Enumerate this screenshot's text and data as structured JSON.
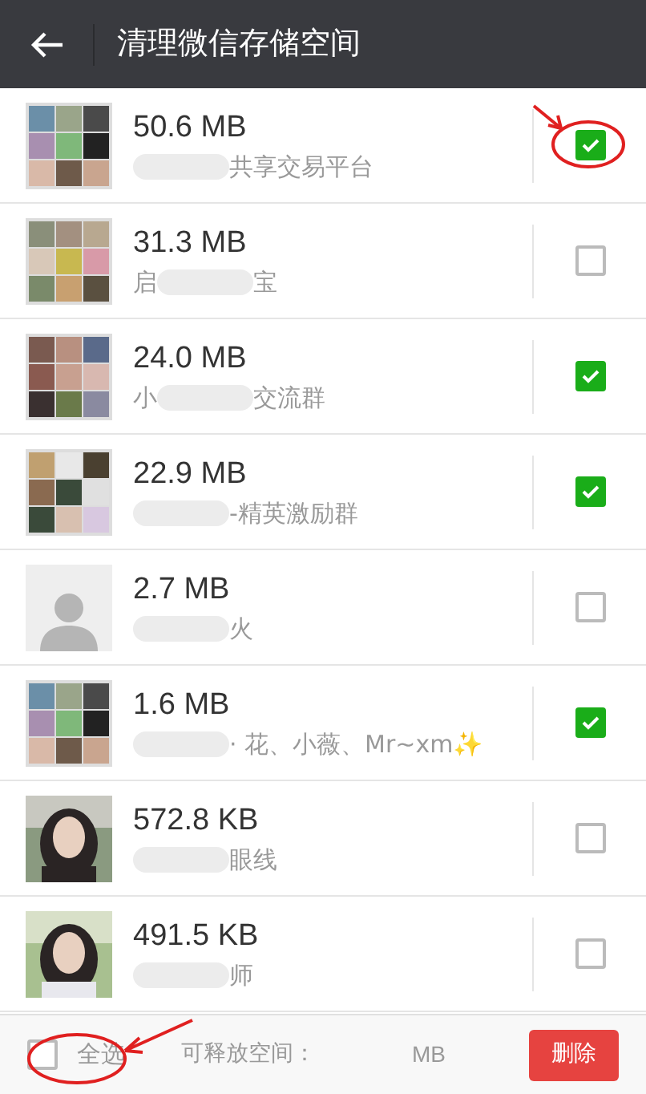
{
  "header": {
    "title": "清理微信存储空间"
  },
  "chats": [
    {
      "size": "50.6 MB",
      "name_after": "共享交易平台",
      "kind": "group",
      "checked": true
    },
    {
      "size": "31.3 MB",
      "name_before": "启",
      "name_after": "宝",
      "kind": "group",
      "checked": false
    },
    {
      "size": "24.0 MB",
      "name_before": "小",
      "name_after": "交流群",
      "kind": "group",
      "checked": true
    },
    {
      "size": "22.9 MB",
      "name_after": "-精英激励群",
      "kind": "group",
      "checked": true
    },
    {
      "size": "2.7 MB",
      "name_after": "火",
      "kind": "default",
      "checked": false
    },
    {
      "size": "1.6 MB",
      "name_after": "· 花、小薇、Mr~xm✨",
      "kind": "group",
      "checked": true
    },
    {
      "size": "572.8 KB",
      "name_after": "眼线",
      "checked": false
    },
    {
      "size": "491.5 KB",
      "name_after": "师",
      "checked": false
    }
  ],
  "footer": {
    "select_all": {
      "label": "全选",
      "checked": false
    },
    "space_label": "可释放空间：",
    "space_unit": "MB",
    "delete_button": "删除"
  }
}
